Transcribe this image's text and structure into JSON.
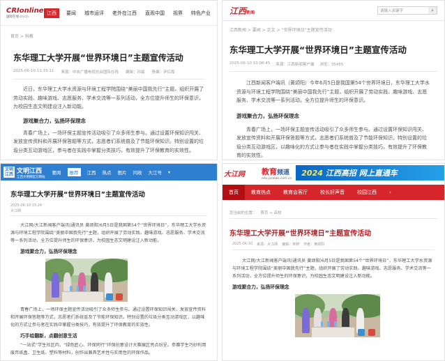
{
  "article": {
    "title": "东华理工大学开展“世界环境日”主题宣传活动",
    "date": "2025-06-10",
    "subheading_1": "游戏聚合力，弘扬环保理念",
    "subheading_2": "巧手绘翻新，点翻创意生活"
  },
  "panel1": {
    "logo_text": "CRIonline",
    "logo_sub": "国际在线 cri.cn",
    "tag": "江西",
    "nav": [
      "要闻",
      "城市运评",
      "老外在江西",
      "直观中国",
      "视界",
      "特色产业"
    ],
    "breadcrumb": "首页 > 科教",
    "timestamp": "2025-06-10 11:15:11",
    "source": "来源：中央广播电视总台国际在线",
    "editor": "编辑：孙晨",
    "reviewer": "责编：尹红霞",
    "para1": "近日，东华理工大学水资源与环境工程学院围绕“美丽中国我先行”主题，组织开展了劳动实践、趣味游戏、志愿服务、学术交流等一系列活动，全方位提升师生的环保意识，为校园生态文明建设注入新动能。",
    "para2": "青春广场上，一场环保主题宣传活动吸引了众多师生参与。通过设置环保知识闯关、发放宣传资料和开展环保答题等方式，志愿者们系统普及了节能环保知识。特别设置的垃圾分类互动游戏区，参与者在实践中掌握分类技巧，有效提升了环保教育的实效性。"
  },
  "panel2": {
    "logo_text": "江西",
    "logo_sub": "新闻",
    "search_placeholder": "请输入关键字",
    "breadcrumb": "江西新闻 > 要闻 > 正文 > “世界环境日”主题宣传活动",
    "timestamp": "2025-06-10 10:06:45",
    "source": "来源：江西新闻客户端",
    "views": "浏览：35455",
    "para1": "江西新闻客户端讯（黄颂阳）今年6月5日是我国第54个世界环境日，东华理工大学水资源与环境工程学院围绕“美丽中国我先行”主题，组织开展了劳动实践、趣味游戏、志愿服务、学术交流等一系列活动，全方位提升师生的环保意识。",
    "para2": "青春广场上，一场环保主题宣传活动吸引了众多师生参与。通过设置环保知识闯关、发放宣传资料和开展环保答题等方式，志愿者们系统普及了节能环保知识。特别设置的垃圾分类互动游戏区，以趣味化的方式让参与者在实践中掌握分类技巧，有效提升了环保教育的实效性。"
  },
  "panel3": {
    "logo_box_top": "文明",
    "logo_box_bottom": "江西",
    "logo_name": "文明江西",
    "logo_slogan": "江西文明网官方网站",
    "nav": [
      "要闻",
      "推荐",
      "江西",
      "热点",
      "图片",
      "问政",
      "大江号"
    ],
    "active_nav": "推荐",
    "timestamp": "2025-06-10 15:24",
    "source": "大江网",
    "para1": "大江网/大江新闻客户端讯(通讯员 黄颂阳)6月5日是我国第54个“世界环境日”，东华理工大学水资源与环境工程学院围绕“美丽中国我先行”主题，组织开展了劳动实践、趣味游戏、志愿服务、学术交流等一系列活动，全方位提升师生的环保意识，为校园生态文明建设注入新动能。",
    "para2": "青春广场上，一场环保主题宣传活动吸引了众多师生参与。通过设置环保知识闯关、发放宣传资料和开展环保答题等方式，志愿者们系统普及了节能环保知识。特别设置的垃圾分类互动游戏区，以趣味化的方式让参与者在实践中掌握分类技巧，有效提升了环保教育的实效性。",
    "para3": "“一站式”学生社区内，“绿色匠心、环保同行”环保创意设计大赛展区亮点纷呈。参赛学生巧妙利用废弃纸盒、卫生纸、塑料等材料，创作出兼具艺术性与实用性的环保作品。"
  },
  "panel4": {
    "dj_logo": "大江网",
    "jy_logo": "教育",
    "jy_logo_suffix": "频道",
    "jy_url": "edu.jxnews.com.cn",
    "banner_year": "2024",
    "banner_text": "江西高招 网上直通车",
    "menu": [
      "首页",
      "教育热点",
      "教育会客厅",
      "校长好声音",
      "校园江西"
    ],
    "active_menu": "首页",
    "crumb_label": "您当前的位置：",
    "crumb_path": "首页 > 高校",
    "timestamp": "2025-06-10",
    "source": "来源：大江网",
    "editor": "编辑：宋婷",
    "author": "作者：黄颂阳",
    "para1": "大江网/大江新闻客户端讯(通讯员 黄颂阳)6月5日是我国第54个“世界环境日”，东华理工大学水资源与环境工程学院围绕“美丽中国我先行”主题，组织开展了劳动实践、趣味游戏、志愿服务、学术交流等一系列活动，全方位提升师生的环保意识，为校园生态文明建设注入新动能。"
  }
}
